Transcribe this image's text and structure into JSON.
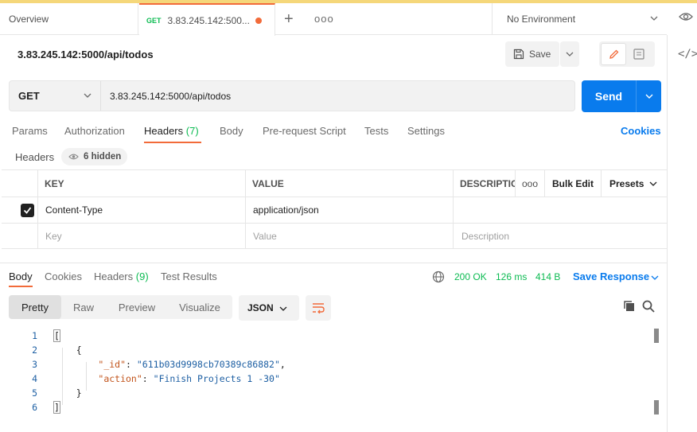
{
  "tabs": {
    "overview": "Overview",
    "active_method": "GET",
    "active_title": "3.83.245.142:500...",
    "plus": "+",
    "more": "ooo",
    "environment": "No Environment"
  },
  "request": {
    "title": "3.83.245.142:5000/api/todos",
    "save_label": "Save",
    "method": "GET",
    "url": "3.83.245.142:5000/api/todos",
    "send_label": "Send"
  },
  "request_tabs": [
    {
      "label": "Params"
    },
    {
      "label": "Authorization"
    },
    {
      "label": "Headers",
      "count": "(7)"
    },
    {
      "label": "Body"
    },
    {
      "label": "Pre-request Script"
    },
    {
      "label": "Tests"
    },
    {
      "label": "Settings"
    }
  ],
  "cookies_label": "Cookies",
  "headers_section": {
    "label": "Headers",
    "hidden": "6 hidden",
    "columns": {
      "key": "KEY",
      "value": "VALUE",
      "description": "DESCRIPTIO"
    },
    "more": "ooo",
    "bulk_edit": "Bulk Edit",
    "presets": "Presets",
    "rows": [
      {
        "key": "Content-Type",
        "value": "application/json",
        "description": ""
      }
    ],
    "placeholder": {
      "key": "Key",
      "value": "Value",
      "description": "Description"
    }
  },
  "response": {
    "tabs": [
      {
        "label": "Body"
      },
      {
        "label": "Cookies"
      },
      {
        "label": "Headers",
        "count": "(9)"
      },
      {
        "label": "Test Results"
      }
    ],
    "status": "200 OK",
    "time": "126 ms",
    "size": "414 B",
    "save_response": "Save Response",
    "views": [
      "Pretty",
      "Raw",
      "Preview",
      "Visualize"
    ],
    "format": "JSON",
    "lines": [
      {
        "n": "1",
        "indent": "",
        "open": "[",
        "key": "",
        "sep": "",
        "val": "",
        "tail": ""
      },
      {
        "n": "2",
        "indent": "    ",
        "open": "{",
        "key": "",
        "sep": "",
        "val": "",
        "tail": ""
      },
      {
        "n": "3",
        "indent": "        ",
        "open": "",
        "key": "\"_id\"",
        "sep": ": ",
        "val": "\"611b03d9998cb70389c86882\"",
        "tail": ","
      },
      {
        "n": "4",
        "indent": "        ",
        "open": "",
        "key": "\"action\"",
        "sep": ": ",
        "val": "\"Finish Projects 1 -30\"",
        "tail": ""
      },
      {
        "n": "5",
        "indent": "    ",
        "open": "}",
        "key": "",
        "sep": "",
        "val": "",
        "tail": ""
      },
      {
        "n": "6",
        "indent": "",
        "open": "]",
        "key": "",
        "sep": "",
        "val": "",
        "tail": ""
      }
    ]
  },
  "colors": {
    "accent": "#f26b3a",
    "primary": "#097bed",
    "success": "#0cbb52"
  }
}
